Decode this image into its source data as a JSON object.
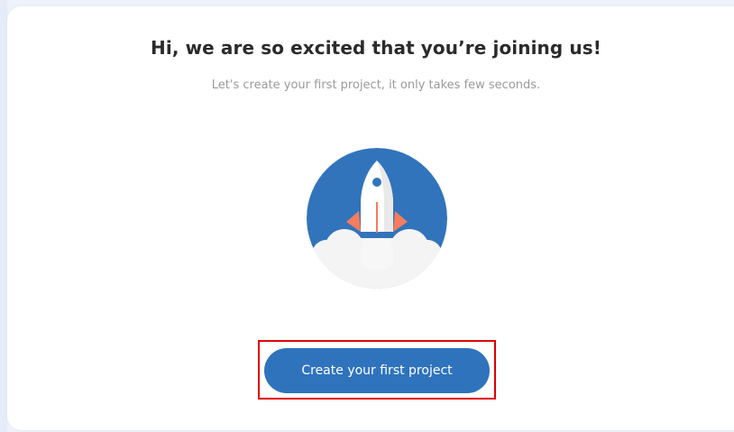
{
  "onboarding": {
    "headline": "Hi, we are so excited that you’re joining us!",
    "subtitle": "Let's create your first project, it only takes few seconds.",
    "illustration_icon": "rocket-launch-icon",
    "cta_label": "Create your first project"
  },
  "colors": {
    "page_background": "#eef2f9",
    "card_background": "#ffffff",
    "accent": "#2f73bd",
    "highlight": "#e00000",
    "headline_text": "#2b2b2b",
    "subtitle_text": "#9a9a9a"
  }
}
